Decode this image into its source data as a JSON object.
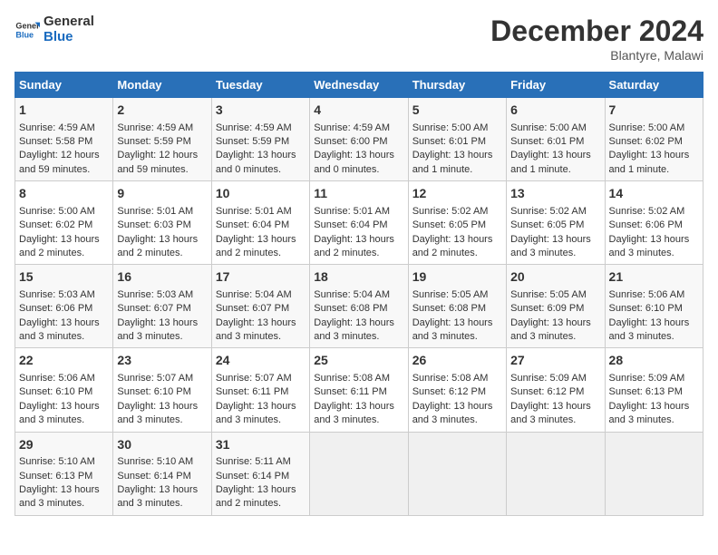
{
  "header": {
    "logo_line1": "General",
    "logo_line2": "Blue",
    "month": "December 2024",
    "location": "Blantyre, Malawi"
  },
  "days_of_week": [
    "Sunday",
    "Monday",
    "Tuesday",
    "Wednesday",
    "Thursday",
    "Friday",
    "Saturday"
  ],
  "weeks": [
    [
      {
        "day": "1",
        "lines": [
          "Sunrise: 4:59 AM",
          "Sunset: 5:58 PM",
          "Daylight: 12 hours",
          "and 59 minutes."
        ]
      },
      {
        "day": "2",
        "lines": [
          "Sunrise: 4:59 AM",
          "Sunset: 5:59 PM",
          "Daylight: 12 hours",
          "and 59 minutes."
        ]
      },
      {
        "day": "3",
        "lines": [
          "Sunrise: 4:59 AM",
          "Sunset: 5:59 PM",
          "Daylight: 13 hours",
          "and 0 minutes."
        ]
      },
      {
        "day": "4",
        "lines": [
          "Sunrise: 4:59 AM",
          "Sunset: 6:00 PM",
          "Daylight: 13 hours",
          "and 0 minutes."
        ]
      },
      {
        "day": "5",
        "lines": [
          "Sunrise: 5:00 AM",
          "Sunset: 6:01 PM",
          "Daylight: 13 hours",
          "and 1 minute."
        ]
      },
      {
        "day": "6",
        "lines": [
          "Sunrise: 5:00 AM",
          "Sunset: 6:01 PM",
          "Daylight: 13 hours",
          "and 1 minute."
        ]
      },
      {
        "day": "7",
        "lines": [
          "Sunrise: 5:00 AM",
          "Sunset: 6:02 PM",
          "Daylight: 13 hours",
          "and 1 minute."
        ]
      }
    ],
    [
      {
        "day": "8",
        "lines": [
          "Sunrise: 5:00 AM",
          "Sunset: 6:02 PM",
          "Daylight: 13 hours",
          "and 2 minutes."
        ]
      },
      {
        "day": "9",
        "lines": [
          "Sunrise: 5:01 AM",
          "Sunset: 6:03 PM",
          "Daylight: 13 hours",
          "and 2 minutes."
        ]
      },
      {
        "day": "10",
        "lines": [
          "Sunrise: 5:01 AM",
          "Sunset: 6:04 PM",
          "Daylight: 13 hours",
          "and 2 minutes."
        ]
      },
      {
        "day": "11",
        "lines": [
          "Sunrise: 5:01 AM",
          "Sunset: 6:04 PM",
          "Daylight: 13 hours",
          "and 2 minutes."
        ]
      },
      {
        "day": "12",
        "lines": [
          "Sunrise: 5:02 AM",
          "Sunset: 6:05 PM",
          "Daylight: 13 hours",
          "and 2 minutes."
        ]
      },
      {
        "day": "13",
        "lines": [
          "Sunrise: 5:02 AM",
          "Sunset: 6:05 PM",
          "Daylight: 13 hours",
          "and 3 minutes."
        ]
      },
      {
        "day": "14",
        "lines": [
          "Sunrise: 5:02 AM",
          "Sunset: 6:06 PM",
          "Daylight: 13 hours",
          "and 3 minutes."
        ]
      }
    ],
    [
      {
        "day": "15",
        "lines": [
          "Sunrise: 5:03 AM",
          "Sunset: 6:06 PM",
          "Daylight: 13 hours",
          "and 3 minutes."
        ]
      },
      {
        "day": "16",
        "lines": [
          "Sunrise: 5:03 AM",
          "Sunset: 6:07 PM",
          "Daylight: 13 hours",
          "and 3 minutes."
        ]
      },
      {
        "day": "17",
        "lines": [
          "Sunrise: 5:04 AM",
          "Sunset: 6:07 PM",
          "Daylight: 13 hours",
          "and 3 minutes."
        ]
      },
      {
        "day": "18",
        "lines": [
          "Sunrise: 5:04 AM",
          "Sunset: 6:08 PM",
          "Daylight: 13 hours",
          "and 3 minutes."
        ]
      },
      {
        "day": "19",
        "lines": [
          "Sunrise: 5:05 AM",
          "Sunset: 6:08 PM",
          "Daylight: 13 hours",
          "and 3 minutes."
        ]
      },
      {
        "day": "20",
        "lines": [
          "Sunrise: 5:05 AM",
          "Sunset: 6:09 PM",
          "Daylight: 13 hours",
          "and 3 minutes."
        ]
      },
      {
        "day": "21",
        "lines": [
          "Sunrise: 5:06 AM",
          "Sunset: 6:10 PM",
          "Daylight: 13 hours",
          "and 3 minutes."
        ]
      }
    ],
    [
      {
        "day": "22",
        "lines": [
          "Sunrise: 5:06 AM",
          "Sunset: 6:10 PM",
          "Daylight: 13 hours",
          "and 3 minutes."
        ]
      },
      {
        "day": "23",
        "lines": [
          "Sunrise: 5:07 AM",
          "Sunset: 6:10 PM",
          "Daylight: 13 hours",
          "and 3 minutes."
        ]
      },
      {
        "day": "24",
        "lines": [
          "Sunrise: 5:07 AM",
          "Sunset: 6:11 PM",
          "Daylight: 13 hours",
          "and 3 minutes."
        ]
      },
      {
        "day": "25",
        "lines": [
          "Sunrise: 5:08 AM",
          "Sunset: 6:11 PM",
          "Daylight: 13 hours",
          "and 3 minutes."
        ]
      },
      {
        "day": "26",
        "lines": [
          "Sunrise: 5:08 AM",
          "Sunset: 6:12 PM",
          "Daylight: 13 hours",
          "and 3 minutes."
        ]
      },
      {
        "day": "27",
        "lines": [
          "Sunrise: 5:09 AM",
          "Sunset: 6:12 PM",
          "Daylight: 13 hours",
          "and 3 minutes."
        ]
      },
      {
        "day": "28",
        "lines": [
          "Sunrise: 5:09 AM",
          "Sunset: 6:13 PM",
          "Daylight: 13 hours",
          "and 3 minutes."
        ]
      }
    ],
    [
      {
        "day": "29",
        "lines": [
          "Sunrise: 5:10 AM",
          "Sunset: 6:13 PM",
          "Daylight: 13 hours",
          "and 3 minutes."
        ]
      },
      {
        "day": "30",
        "lines": [
          "Sunrise: 5:10 AM",
          "Sunset: 6:14 PM",
          "Daylight: 13 hours",
          "and 3 minutes."
        ]
      },
      {
        "day": "31",
        "lines": [
          "Sunrise: 5:11 AM",
          "Sunset: 6:14 PM",
          "Daylight: 13 hours",
          "and 2 minutes."
        ]
      },
      {
        "day": "",
        "lines": []
      },
      {
        "day": "",
        "lines": []
      },
      {
        "day": "",
        "lines": []
      },
      {
        "day": "",
        "lines": []
      }
    ]
  ]
}
